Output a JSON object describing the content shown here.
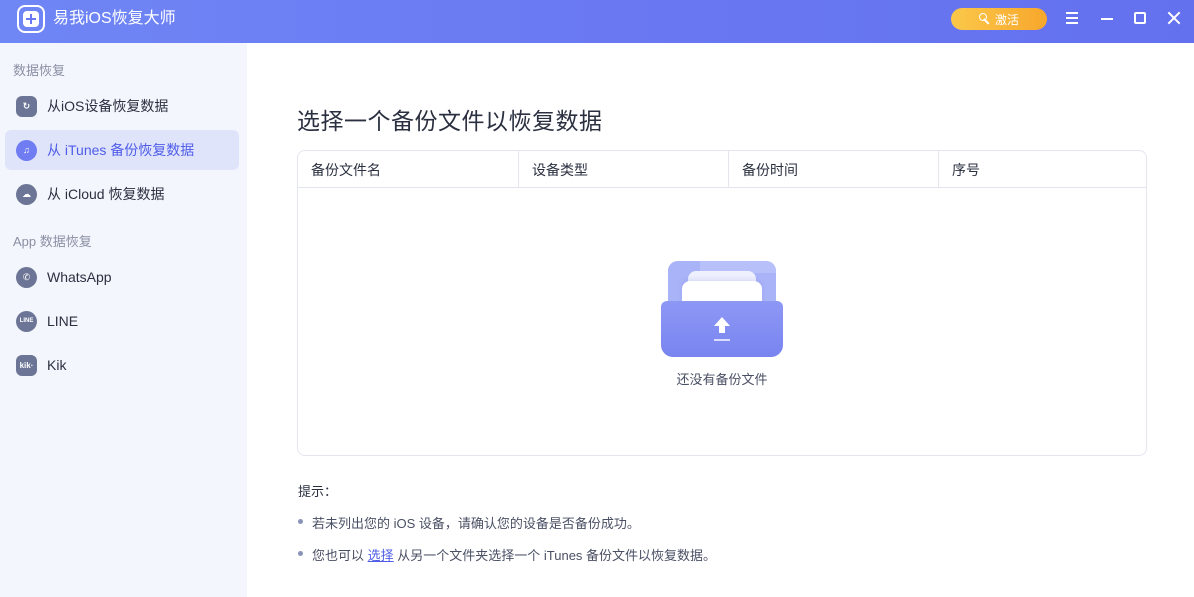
{
  "app": {
    "title": "易我iOS恢复大师",
    "activate_label": "激活"
  },
  "sidebar": {
    "section1": "数据恢复",
    "section2": "App 数据恢复",
    "items": [
      {
        "label": "从iOS设备恢复数据",
        "icon": "refresh-device-icon"
      },
      {
        "label": "从 iTunes 备份恢复数据",
        "icon": "music-note-icon"
      },
      {
        "label": "从 iCloud 恢复数据",
        "icon": "cloud-icon"
      },
      {
        "label": "WhatsApp",
        "icon": "whatsapp-icon"
      },
      {
        "label": "LINE",
        "icon": "line-icon",
        "badge": "LINE"
      },
      {
        "label": "Kik",
        "icon": "kik-icon",
        "badge": "kik·"
      }
    ]
  },
  "main": {
    "title": "选择一个备份文件以恢复数据",
    "columns": [
      "备份文件名",
      "设备类型",
      "备份时间",
      "序号"
    ],
    "empty_text": "还没有备份文件",
    "tips_title": "提示：",
    "tip1": "若未列出您的 iOS 设备，请确认您的设备是否备份成功。",
    "tip2_before": "您也可以",
    "tip2_link": "选择",
    "tip2_after": "从另一个文件夹选择一个 iTunes 备份文件以恢复数据。"
  }
}
